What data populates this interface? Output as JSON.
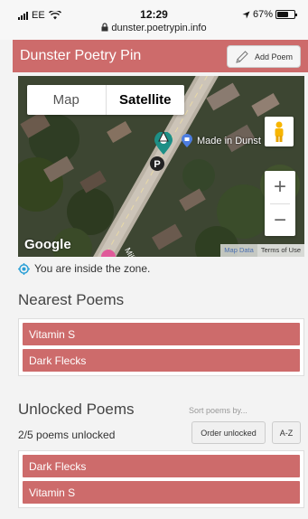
{
  "status_bar": {
    "carrier": "EE",
    "time": "12:29",
    "battery_percent": "67%",
    "battery_level": 0.67,
    "url": "dunster.poetrypin.info"
  },
  "header": {
    "title": "Dunster Poetry Pin",
    "add_poem_label": "Add Poem"
  },
  "map": {
    "tab_map": "Map",
    "tab_satellite": "Satellite",
    "active_tab": "Satellite",
    "place_label": "Made in Dunst",
    "zoom_in": "+",
    "zoom_out": "−",
    "google_logo": "Google",
    "map_data": "Map Data",
    "terms": "Terms of Use"
  },
  "zone_status": "You are inside the zone.",
  "nearest": {
    "heading": "Nearest Poems",
    "poems": [
      "Vitamin S",
      "Dark Flecks"
    ]
  },
  "unlocked": {
    "heading": "Unlocked Poems",
    "sort_label": "Sort poems by...",
    "count_text": "2/5 poems unlocked",
    "sort_order_unlocked": "Order unlocked",
    "sort_az": "A-Z",
    "poems": [
      "Dark Flecks",
      "Vitamin S"
    ]
  },
  "colors": {
    "accent": "#cd6b6b",
    "zone_icon": "#2a9fd6"
  }
}
